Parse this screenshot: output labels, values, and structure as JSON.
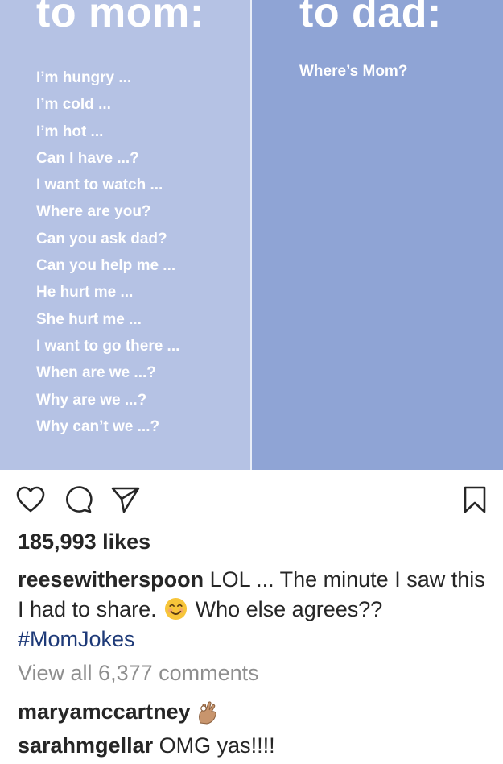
{
  "post_image": {
    "mom_column": {
      "heading": "to mom:",
      "phrases": [
        "I’m hungry ...",
        "I’m cold ...",
        "I’m hot ...",
        "Can I have ...?",
        "I want to watch ...",
        "Where are you?",
        "Can you ask dad?",
        "Can you help me ...",
        "He hurt me ...",
        "She hurt me ...",
        "I want to go there ...",
        "When are we ...?",
        "Why are we ...?",
        "Why can’t we ...?"
      ]
    },
    "dad_column": {
      "heading": "to dad:",
      "phrase": "Where’s Mom?"
    },
    "colors": {
      "left_bg": "#b5c2e4",
      "right_bg": "#8fa4d5"
    }
  },
  "actions": {
    "icons": [
      "heart-icon",
      "comment-icon",
      "share-icon",
      "bookmark-icon"
    ]
  },
  "likes": "185,993 likes",
  "caption": {
    "username": "reesewitherspoon",
    "text_part1": " LOL ... The minute I saw this I had to share. ",
    "emoji": "smiling-face-emoji",
    "text_part2": " Who else agrees?? ",
    "hashtag": "#MomJokes"
  },
  "view_all_comments": "View all 6,377 comments",
  "comments": [
    {
      "username": "maryamccartney",
      "text": "",
      "emoji": "ok-hand-emoji"
    },
    {
      "username": "sarahmgellar",
      "text": " OMG yas!!!!"
    }
  ],
  "colors": {
    "text": "#262626",
    "muted": "#8e8e8e",
    "hashtag": "#1e3a78"
  }
}
